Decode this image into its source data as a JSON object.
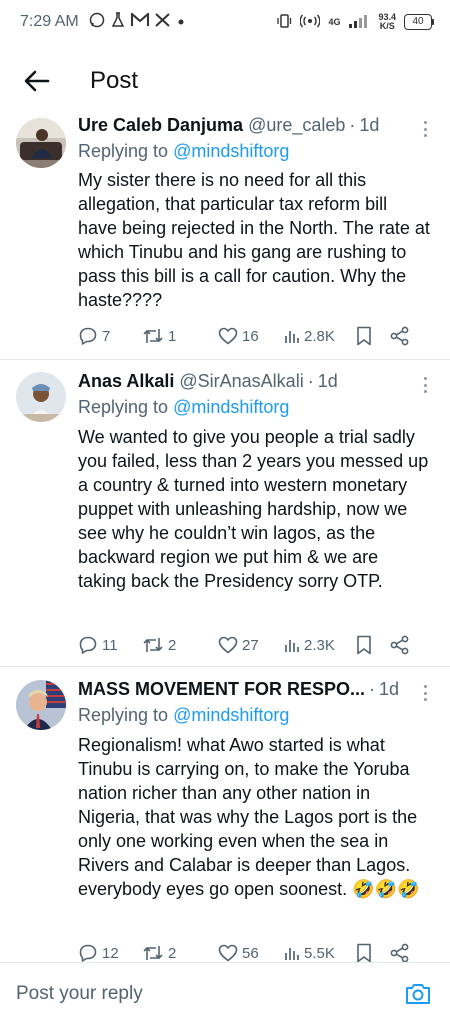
{
  "status_bar": {
    "time": "7:29 AM",
    "network": "4G",
    "speed_value": "93.4",
    "speed_unit": "K/S",
    "battery": "40"
  },
  "header": {
    "title": "Post"
  },
  "tweets": [
    {
      "name": "Ure Caleb Danjuma",
      "handle": "@ure_caleb",
      "time": "1d",
      "replying_prefix": "Replying to ",
      "replying_to": "@mindshiftorg",
      "text": "My sister there is no need for all this allegation, that particular tax  reform bill have being rejected in the North. The rate at which Tinubu and his gang are rushing to pass this bill is a call for caution. Why the haste????",
      "replies": "7",
      "retweets": "1",
      "likes": "16",
      "views": "2.8K"
    },
    {
      "name": "Anas Alkali",
      "handle": "@SirAnasAlkali",
      "time": "1d",
      "replying_prefix": "Replying to ",
      "replying_to": "@mindshiftorg",
      "text": "We wanted to give you people a trial sadly you failed, less than 2 years you messed up a country & turned into western monetary puppet with unleashing  hardship, now we see why he couldn’t win lagos, as the backward region we put him & we are taking back the Presidency sorry OTP.",
      "replies": "11",
      "retweets": "2",
      "likes": "27",
      "views": "2.3K"
    },
    {
      "name": "MASS MOVEMENT FOR RESPO...",
      "handle": "",
      "time": "1d",
      "replying_prefix": "Replying to ",
      "replying_to": "@mindshiftorg",
      "text": "Regionalism! what Awo started is what Tinubu is carrying on, to make the Yoruba nation richer than any other nation in Nigeria, that was why the Lagos port is the only one working even when the sea in Rivers and Calabar is deeper than Lagos. everybody eyes go open soonest. 🤣🤣🤣",
      "replies": "12",
      "retweets": "2",
      "likes": "56",
      "views": "5.5K"
    }
  ],
  "reply_bar": {
    "placeholder": "Post your reply"
  },
  "colors": {
    "accent": "#1d9bf0",
    "secondary_text": "#536471",
    "divider": "#e6e9eb"
  },
  "icons": [
    "back-arrow-icon",
    "more-icon",
    "reply-icon",
    "retweet-icon",
    "like-icon",
    "views-icon",
    "bookmark-icon",
    "share-icon",
    "camera-icon"
  ]
}
